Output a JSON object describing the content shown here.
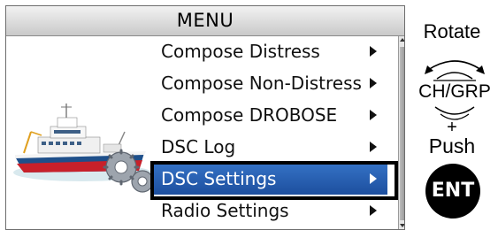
{
  "menu": {
    "title": "MENU",
    "items": [
      {
        "label": "Compose Distress"
      },
      {
        "label": "Compose Non-Distress"
      },
      {
        "label": "Compose DROBOSE"
      },
      {
        "label": "DSC Log"
      },
      {
        "label": "DSC Settings",
        "selected": true
      },
      {
        "label": "Radio Settings"
      }
    ]
  },
  "instructions": {
    "rotate": "Rotate",
    "knob": "CH/GRP",
    "plus": "+",
    "push": "Push",
    "ent": "ENT"
  },
  "colors": {
    "selected_bg": "#2a62b5",
    "selected_text": "#ffffff",
    "frame": "#000000"
  },
  "icons": [
    "ship-illustration",
    "channel-knob-icon",
    "submenu-arrow-icon"
  ]
}
